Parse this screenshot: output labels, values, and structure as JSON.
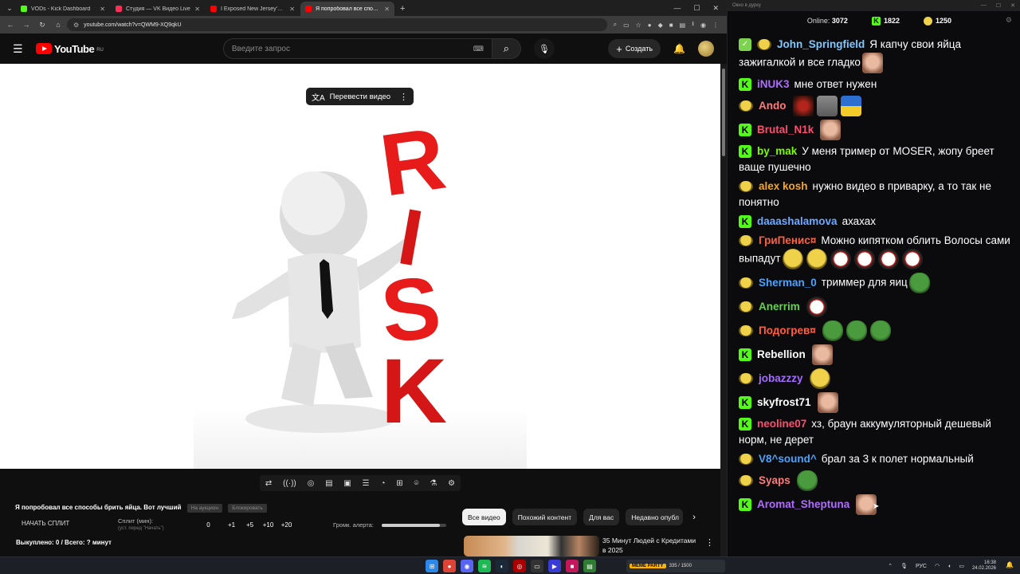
{
  "browser": {
    "tabs": [
      {
        "title": "VODs - Kick Dashboard",
        "color": "#53fc18"
      },
      {
        "title": "Студия — VK Видео Live",
        "color": "#ff2d55"
      },
      {
        "title": "I Exposed New Jersey's Jewish",
        "color": "#ff0000"
      },
      {
        "title": "Я попробовал все способ",
        "color": "#ff0000",
        "active": true
      }
    ],
    "url": "youtube.com/watch?v=QWM9-XQ9qkU"
  },
  "youtube": {
    "logo_text": "YouTube",
    "region": "RU",
    "search_placeholder": "Введите запрос",
    "create_label": "Создать",
    "translate_label": "Перевести видео"
  },
  "video": {
    "title": "Я попробовал все способы брить яйца. Вот лучший",
    "badge1": "На аукцион",
    "badge2": "Блокировать",
    "start_split": "НАЧАТЬ СПЛИТ",
    "split_label": "Сплит (мин):",
    "split_sub": "(уст. перед \"Начать\")",
    "split_values": [
      "0",
      "+1",
      "+5",
      "+10",
      "+20"
    ],
    "alert_label": "Громк. алерта:",
    "alert_level": 0.9,
    "bought": "Выкуплено: 0 / Всего: ? минут"
  },
  "chips": [
    "Все видео",
    "Похожий контент",
    "Для вас",
    "Недавно опубл"
  ],
  "recommendation": {
    "title": "35 Минут Людей с Кредитами в 2025"
  },
  "chat": {
    "window_title": "Окно в дурку",
    "online_label": "Online:",
    "online_count": "3072",
    "kick_count": "1822",
    "other_count": "1250",
    "messages": [
      {
        "badge": "green",
        "nick": "John_Springfield",
        "color": "#7ec8ff",
        "text": "Я капчу свои яйца зажигалкой и все гладко",
        "emotes": [
          "em-face"
        ]
      },
      {
        "badge": "kick",
        "nick": "iNUK3",
        "color": "#b06cff",
        "text": "мне ответ нужен",
        "emotes": []
      },
      {
        "badge": "smile",
        "nick": "Ando",
        "color": "#ff7a7a",
        "text": "",
        "emotes": [
          "em-dark",
          "em-gray",
          "em-ua"
        ]
      },
      {
        "badge": "kick",
        "nick": "Brutal_N1k",
        "color": "#ff4d6d",
        "text": "",
        "emotes": [
          "em-face"
        ]
      },
      {
        "badge": "kick",
        "nick": "by_mak",
        "color": "#7CFC00",
        "text": "У меня тример от MOSER, жопу бреет ваще пушечно",
        "emotes": []
      },
      {
        "badge": "smile",
        "nick": "alex kosh",
        "color": "#f5a623",
        "text": "нужно видео в приварку, а то так не понятно",
        "emotes": []
      },
      {
        "badge": "kick",
        "nick": "daaashalamova",
        "color": "#6fa8ff",
        "text": "ахахах",
        "emotes": []
      },
      {
        "badge": "smile",
        "nick": "ГриПенис¤",
        "color": "#ff5f3d",
        "text": "Можно кипятком облить Волосы сами выпадут",
        "emotes": [
          "em-smile",
          "em-smile",
          "em-jester",
          "em-jester",
          "em-jester",
          "em-jester"
        ]
      },
      {
        "badge": "smile",
        "nick": "Sherman_0",
        "color": "#4aa3ff",
        "text": "триммер для яиц",
        "emotes": [
          "em-pepe"
        ]
      },
      {
        "badge": "smile",
        "nick": "Anerrim",
        "color": "#63d34a",
        "text": "",
        "emotes": [
          "em-jester"
        ]
      },
      {
        "badge": "smile",
        "nick": "Подогрев¤",
        "color": "#ff5f3d",
        "text": "",
        "emotes": [
          "em-pepe",
          "em-pepe",
          "em-pepe"
        ]
      },
      {
        "badge": "kick",
        "nick": "Rebellion",
        "color": "#ffffff",
        "text": "",
        "emotes": [
          "em-face"
        ]
      },
      {
        "badge": "smile",
        "nick": "jobazzzy",
        "color": "#a56bff",
        "text": "",
        "emotes": [
          "em-smile"
        ]
      },
      {
        "badge": "kick",
        "nick": "skyfrost71",
        "color": "#ffffff",
        "text": "",
        "emotes": [
          "em-face"
        ]
      },
      {
        "badge": "kick",
        "nick": "neoline07",
        "color": "#ff4d6d",
        "text": "хз, браун аккумуляторный дешевый норм, не дерет",
        "emotes": []
      },
      {
        "badge": "smile",
        "nick": "V8^sound^",
        "color": "#4aa3ff",
        "text": "брал за 3 к полет нормальный",
        "emotes": []
      },
      {
        "badge": "smile",
        "nick": "Syaps",
        "color": "#ff7a7a",
        "text": "",
        "emotes": [
          "em-pepe"
        ]
      },
      {
        "badge": "kick",
        "nick": "Aromat_Sheptuna",
        "color": "#b06cff",
        "text": "",
        "emotes": [
          "em-face"
        ]
      }
    ]
  },
  "taskbar": {
    "widget_title": "MEME PARTY",
    "widget_count": "335 / 1500",
    "lang": "РУС",
    "time": "16:38",
    "date": "24.02.2026"
  }
}
